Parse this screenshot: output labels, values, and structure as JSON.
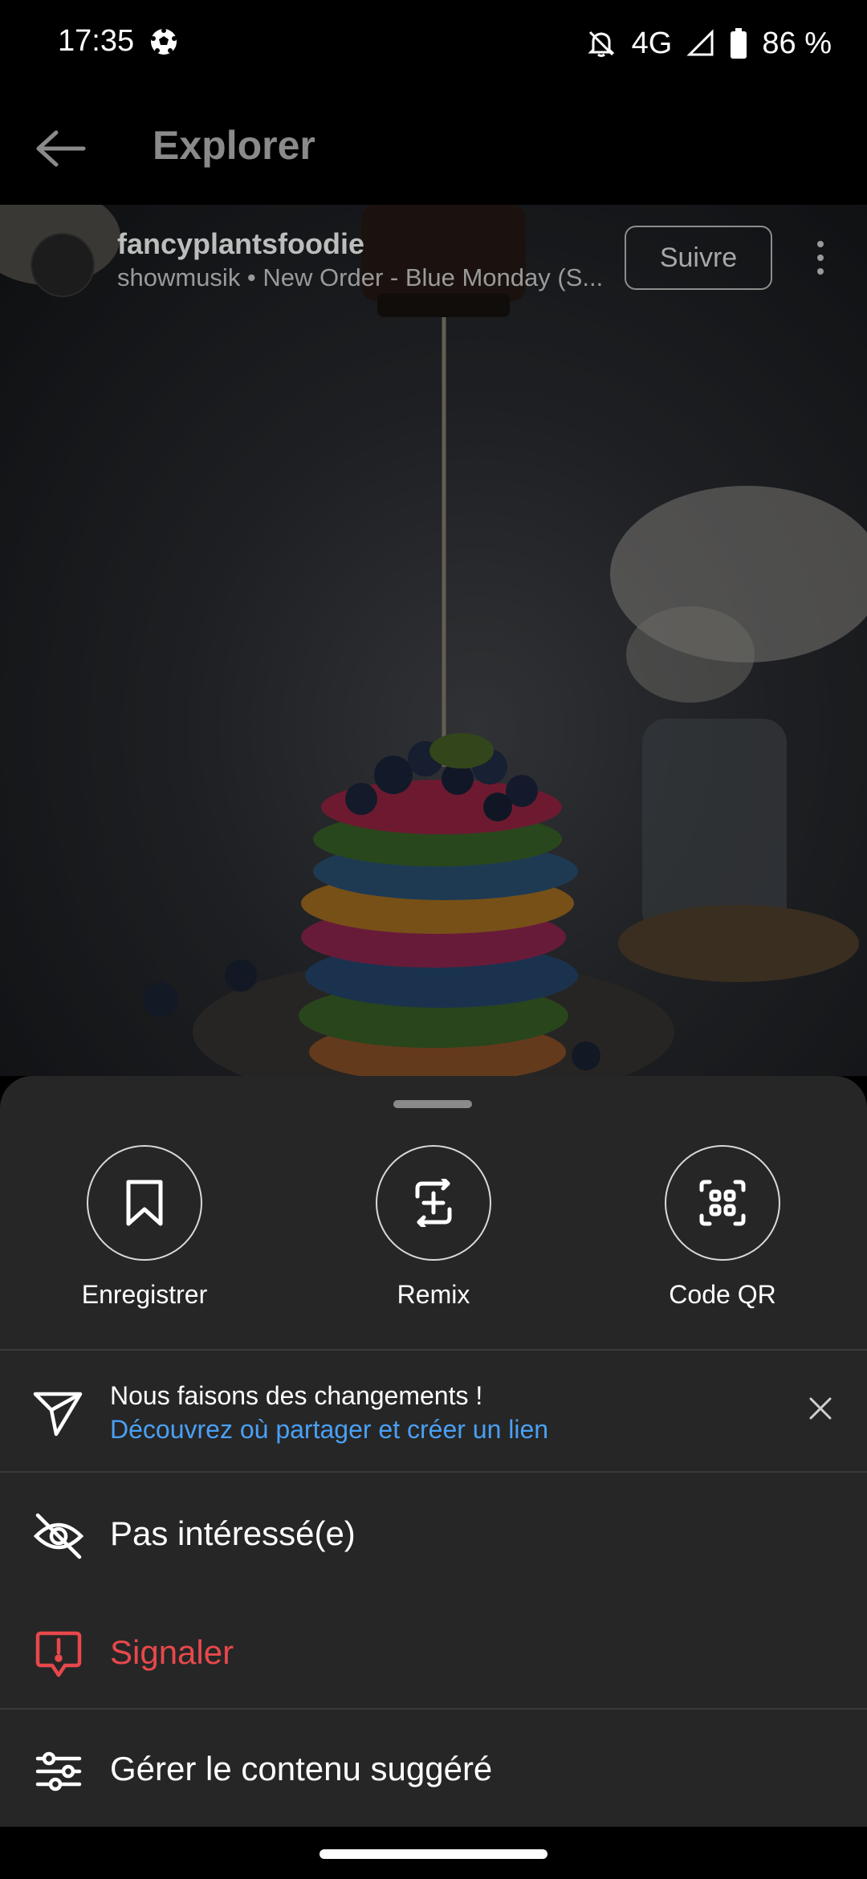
{
  "status_bar": {
    "time": "17:35",
    "network": "4G",
    "battery": "86 %"
  },
  "header": {
    "title": "Explorer"
  },
  "post": {
    "username": "fancyplantsfoodie",
    "music": "showmusik • New Order - Blue Monday (S...",
    "follow_label": "Suivre"
  },
  "sheet": {
    "actions": [
      {
        "label": "Enregistrer",
        "icon": "bookmark-icon"
      },
      {
        "label": "Remix",
        "icon": "remix-icon"
      },
      {
        "label": "Code QR",
        "icon": "qr-code-icon"
      }
    ],
    "notice": {
      "title": "Nous faisons des changements !",
      "link": "Découvrez où partager et créer un lien"
    },
    "menu": [
      {
        "label": "Pas intéressé(e)",
        "icon": "eye-off-icon"
      },
      {
        "label": "Signaler",
        "icon": "report-icon",
        "color": "#e8484b"
      },
      {
        "label": "Gérer le contenu suggéré",
        "icon": "sliders-icon"
      }
    ]
  },
  "colors": {
    "sheet_background": "#262626",
    "link": "#4aa0f5",
    "danger": "#e8484b"
  }
}
